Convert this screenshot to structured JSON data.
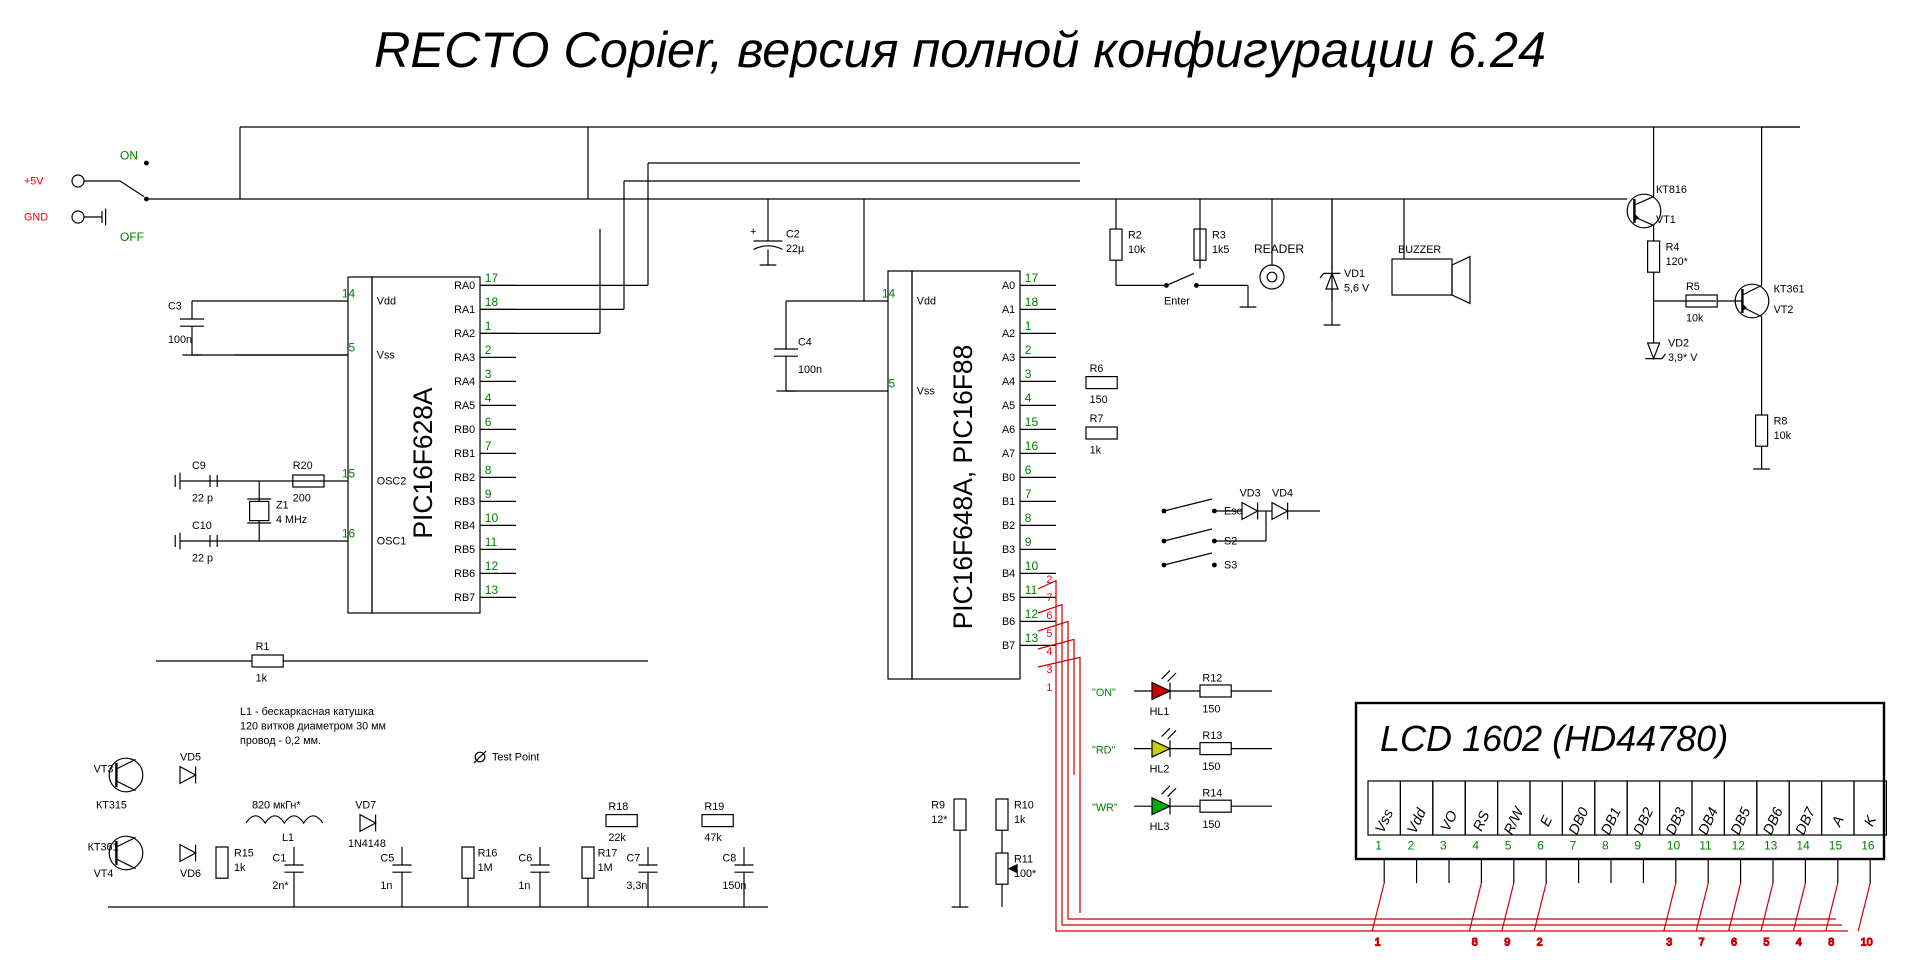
{
  "title": "RECTO Copier, версия полной конфигурации 6.24",
  "power": {
    "v5": "+5V",
    "gnd": "GND",
    "on": "ON",
    "off": "OFF"
  },
  "chips": {
    "u1": {
      "name": "PIC16F628A",
      "left": [
        {
          "num": "14",
          "label": "Vdd"
        },
        {
          "num": "5",
          "label": "Vss"
        },
        {
          "num": "15",
          "label": "OSC2"
        },
        {
          "num": "16",
          "label": "OSC1"
        }
      ],
      "right": [
        {
          "num": "17",
          "label": "RA0"
        },
        {
          "num": "18",
          "label": "RA1"
        },
        {
          "num": "1",
          "label": "RA2"
        },
        {
          "num": "2",
          "label": "RA3"
        },
        {
          "num": "3",
          "label": "RA4"
        },
        {
          "num": "4",
          "label": "RA5"
        },
        {
          "num": "6",
          "label": "RB0"
        },
        {
          "num": "7",
          "label": "RB1"
        },
        {
          "num": "8",
          "label": "RB2"
        },
        {
          "num": "9",
          "label": "RB3"
        },
        {
          "num": "10",
          "label": "RB4"
        },
        {
          "num": "11",
          "label": "RB5"
        },
        {
          "num": "12",
          "label": "RB6"
        },
        {
          "num": "13",
          "label": "RB7"
        }
      ]
    },
    "u2": {
      "name": "PIC16F648A, PIC16F88",
      "left": [
        {
          "num": "14",
          "label": "Vdd"
        },
        {
          "num": "5",
          "label": "Vss"
        }
      ],
      "right": [
        {
          "num": "17",
          "label": "A0"
        },
        {
          "num": "18",
          "label": "A1"
        },
        {
          "num": "1",
          "label": "A2"
        },
        {
          "num": "2",
          "label": "A3"
        },
        {
          "num": "3",
          "label": "A4"
        },
        {
          "num": "4",
          "label": "A5"
        },
        {
          "num": "15",
          "label": "A6"
        },
        {
          "num": "16",
          "label": "A7"
        },
        {
          "num": "6",
          "label": "B0"
        },
        {
          "num": "7",
          "label": "B1"
        },
        {
          "num": "8",
          "label": "B2"
        },
        {
          "num": "9",
          "label": "B3"
        },
        {
          "num": "10",
          "label": "B4"
        },
        {
          "num": "11",
          "label": "B5"
        },
        {
          "num": "12",
          "label": "B6"
        },
        {
          "num": "13",
          "label": "B7"
        }
      ]
    }
  },
  "lcd": {
    "title": "LCD 1602 (HD44780)",
    "pins": [
      "Vss",
      "Vdd",
      "VO",
      "RS",
      "R/W",
      "E",
      "DB0",
      "DB1",
      "DB2",
      "DB3",
      "DB4",
      "DB5",
      "DB6",
      "DB7",
      "A",
      "K"
    ],
    "nums": [
      "1",
      "2",
      "3",
      "4",
      "5",
      "6",
      "7",
      "8",
      "9",
      "10",
      "11",
      "12",
      "13",
      "14",
      "15",
      "16"
    ],
    "bus": [
      "1",
      "8",
      "9",
      "2",
      "3",
      "7",
      "6",
      "5",
      "4",
      "8",
      "10"
    ]
  },
  "parts": {
    "C2": {
      "ref": "C2",
      "val": "22µ"
    },
    "C3": {
      "ref": "C3",
      "val": "100n"
    },
    "C4": {
      "ref": "C4",
      "val": "100n"
    },
    "C9": {
      "ref": "C9",
      "val": "22 p"
    },
    "C10": {
      "ref": "C10",
      "val": "22 p"
    },
    "Z1": {
      "ref": "Z1",
      "val": "4 MHz"
    },
    "R20": {
      "ref": "R20",
      "val": "200"
    },
    "R1": {
      "ref": "R1",
      "val": "1k"
    },
    "R2": {
      "ref": "R2",
      "val": "10k"
    },
    "R3": {
      "ref": "R3",
      "val": "1k5"
    },
    "R4": {
      "ref": "R4",
      "val": "120*"
    },
    "R5": {
      "ref": "R5",
      "val": "10k"
    },
    "R6": {
      "ref": "R6",
      "val": "150"
    },
    "R7": {
      "ref": "R7",
      "val": "1k"
    },
    "R8": {
      "ref": "R8",
      "val": "10k"
    },
    "R9": {
      "ref": "R9",
      "val": "12*"
    },
    "R10": {
      "ref": "R10",
      "val": "1k"
    },
    "R11": {
      "ref": "R11",
      "val": "100*"
    },
    "R12": {
      "ref": "R12",
      "val": "150"
    },
    "R13": {
      "ref": "R13",
      "val": "150"
    },
    "R14": {
      "ref": "R14",
      "val": "150"
    },
    "R15": {
      "ref": "R15",
      "val": "1k"
    },
    "R16": {
      "ref": "R16",
      "val": "1M"
    },
    "R17": {
      "ref": "R17",
      "val": "1M"
    },
    "R18": {
      "ref": "R18",
      "val": "22k"
    },
    "R19": {
      "ref": "R19",
      "val": "47k"
    },
    "C1": {
      "ref": "C1",
      "val": "2n*"
    },
    "C5": {
      "ref": "C5",
      "val": "1n"
    },
    "C6": {
      "ref": "C6",
      "val": "1n"
    },
    "C7": {
      "ref": "C7",
      "val": "3,3n"
    },
    "C8": {
      "ref": "C8",
      "val": "150n"
    },
    "L1": {
      "ref": "L1",
      "val": "820 мкГн*"
    },
    "VD1": {
      "ref": "VD1",
      "val": "5,6 V"
    },
    "VD2": {
      "ref": "VD2",
      "val": "3,9* V"
    },
    "VD3": {
      "ref": "VD3",
      "val": ""
    },
    "VD4": {
      "ref": "VD4",
      "val": ""
    },
    "VD5": {
      "ref": "VD5",
      "val": ""
    },
    "VD6": {
      "ref": "VD6",
      "val": ""
    },
    "VD7": {
      "ref": "VD7",
      "val": "1N4148"
    },
    "VT1": {
      "ref": "VT1",
      "val": "КТ816"
    },
    "VT2": {
      "ref": "VT2",
      "val": "КТ361"
    },
    "VT3": {
      "ref": "VT3",
      "val": "КТ315"
    },
    "VT4": {
      "ref": "VT4",
      "val": "КТ361"
    },
    "HL1": {
      "ref": "HL1",
      "val": "\"ON\"",
      "c": "#c00"
    },
    "HL2": {
      "ref": "HL2",
      "val": "\"RD\"",
      "c": "#cc0"
    },
    "HL3": {
      "ref": "HL3",
      "val": "\"WR\"",
      "c": "#0a0"
    }
  },
  "labels": {
    "reader": "READER",
    "enter": "Enter",
    "esc": "Esc",
    "s2": "S2",
    "s3": "S3",
    "buzzer": "BUZZER",
    "tp": "Test Point",
    "coil": "L1 - бескаркасная катушка\n120 витков диаметром 30 мм\nпровод - 0,2 мм."
  },
  "bus_u2": [
    "2",
    "7",
    "6",
    "5",
    "4",
    "3",
    "1"
  ]
}
